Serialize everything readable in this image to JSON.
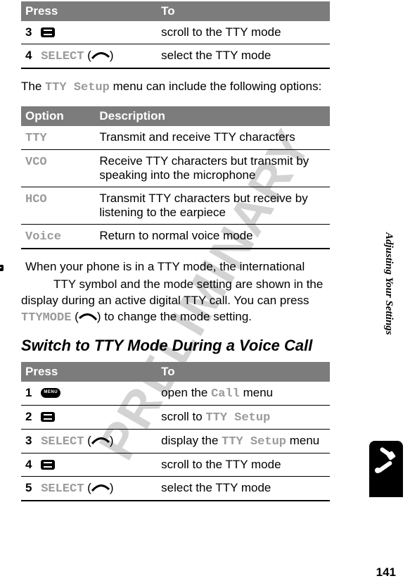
{
  "watermark": "PRELIMINARY",
  "tables": {
    "t1": {
      "headers": [
        "Press",
        "To"
      ],
      "rows": [
        {
          "num": "3",
          "left_icon": "nav",
          "left_extra": "",
          "right": "scroll to the TTY mode"
        },
        {
          "num": "4",
          "left_mono": "SELECT",
          "left_paren_icon": "softkey-r",
          "right": "select the TTY mode"
        }
      ]
    },
    "t2": {
      "headers": [
        "Option",
        "Description"
      ],
      "rows": [
        {
          "opt": "TTY",
          "desc": "Transmit and receive TTY characters"
        },
        {
          "opt": "VCO",
          "desc": "Receive TTY characters but transmit by speaking into the microphone"
        },
        {
          "opt": "HCO",
          "desc": "Transmit TTY characters but receive by listening to the earpiece"
        },
        {
          "opt": "Voice",
          "desc": "Return to normal voice mode"
        }
      ]
    },
    "t3": {
      "headers": [
        "Press",
        "To"
      ],
      "rows": [
        {
          "num": "1",
          "left_icon": "menu",
          "right_pre": "open the ",
          "right_mono": "Call",
          "right_post": " menu"
        },
        {
          "num": "2",
          "left_icon": "nav",
          "right_pre": "scroll to ",
          "right_mono": "TTY Setup",
          "right_post": ""
        },
        {
          "num": "3",
          "left_mono": "SELECT",
          "left_paren_icon": "softkey-r",
          "right_pre": "display the ",
          "right_mono": "TTY Setup",
          "right_post": " menu"
        },
        {
          "num": "4",
          "left_icon": "nav",
          "right_pre": "scroll to the TTY mode",
          "right_mono": "",
          "right_post": ""
        },
        {
          "num": "5",
          "left_mono": "SELECT",
          "left_paren_icon": "softkey-r",
          "right_pre": "select the TTY mode",
          "right_mono": "",
          "right_post": ""
        }
      ]
    }
  },
  "para1_pre": "The ",
  "para1_mono": "TTY Setup",
  "para1_post": " menu can include the following options:",
  "para2_line1": "When your phone is in a TTY mode, the international",
  "para2_line2": "TTY symbol and the mode setting are shown in the",
  "para2_rest_pre": "display during an active digital TTY call. You can press ",
  "para2_mono": "TTYMODE",
  "para2_rest_post": " to change the mode setting.",
  "heading": "Switch to TTY Mode During a Voice Call",
  "side_label": "Adjusting Your Settings",
  "page_number": "141"
}
